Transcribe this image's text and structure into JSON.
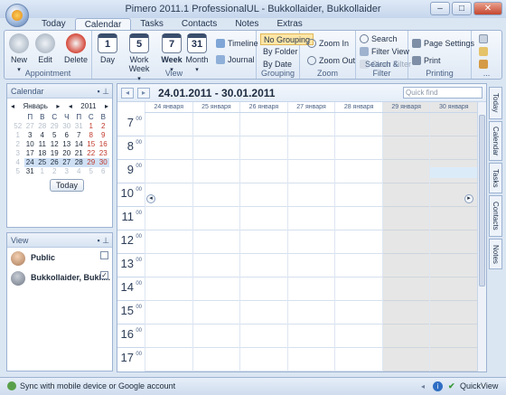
{
  "title": "Pimero 2011.1 ProfessionalUL - Bukkollaider, Bukkollaider",
  "window_buttons": {
    "minimize": "–",
    "maximize": "□",
    "close": "✕"
  },
  "tabs": [
    "Today",
    "Calendar",
    "Tasks",
    "Contacts",
    "Notes",
    "Extras"
  ],
  "ribbon": {
    "appointment": {
      "label": "Appointment",
      "new": "New",
      "edit": "Edit",
      "delete": "Delete"
    },
    "view": {
      "label": "View",
      "day": "Day",
      "work_week": "Work Week",
      "week": "Week",
      "month": "Month",
      "day_num": "1",
      "work_week_num": "5",
      "week_num": "7",
      "month_num": "31",
      "timeline": "Timeline",
      "journal": "Journal"
    },
    "grouping": {
      "label": "Grouping",
      "no_grouping": "No Grouping",
      "by_folder": "By Folder",
      "by_date": "By Date"
    },
    "zoom": {
      "label": "Zoom",
      "zoom_in": "Zoom In",
      "zoom_out": "Zoom Out"
    },
    "search_filter": {
      "label": "Search & Filter",
      "search": "Search",
      "filter_view": "Filter View",
      "clear_filter": "Clear Filter"
    },
    "printing": {
      "label": "Printing",
      "page_settings": "Page Settings",
      "print": "Print"
    },
    "more": "..."
  },
  "calendar_panel": {
    "title": "Calendar",
    "month": "Январь",
    "year": "2011",
    "weekdays": [
      "П",
      "В",
      "С",
      "Ч",
      "П",
      "С",
      "В"
    ],
    "rows": [
      [
        "27",
        "28",
        "29",
        "30",
        "31",
        "1",
        "2"
      ],
      [
        "3",
        "4",
        "5",
        "6",
        "7",
        "8",
        "9"
      ],
      [
        "10",
        "11",
        "12",
        "13",
        "14",
        "15",
        "16"
      ],
      [
        "17",
        "18",
        "19",
        "20",
        "21",
        "22",
        "23"
      ],
      [
        "24",
        "25",
        "26",
        "27",
        "28",
        "29",
        "30"
      ],
      [
        "31",
        "1",
        "2",
        "3",
        "4",
        "5",
        "6"
      ]
    ],
    "week_numbers": [
      "52",
      "1",
      "2",
      "3",
      "4",
      "5"
    ],
    "today_button": "Today"
  },
  "view_panel": {
    "title": "View",
    "items": [
      {
        "name": "Public",
        "checked": false
      },
      {
        "name": "Bukkollaider, Bukk...",
        "checked": true
      }
    ]
  },
  "main": {
    "date_range": "24.01.2011 - 30.01.2011",
    "quick_find_placeholder": "Quick find",
    "days": [
      "24 января",
      "25 января",
      "26 января",
      "27 января",
      "28 января",
      "29 января",
      "30 января"
    ],
    "hours": [
      "7",
      "8",
      "9",
      "10",
      "11",
      "12",
      "13",
      "14",
      "15",
      "16",
      "17"
    ],
    "minutes_label": "00"
  },
  "side_tabs": [
    "Today",
    "Calendar",
    "Tasks",
    "Contacts",
    "Notes"
  ],
  "status": {
    "sync": "Sync with mobile device or Google account",
    "quickview": "QuickView"
  }
}
